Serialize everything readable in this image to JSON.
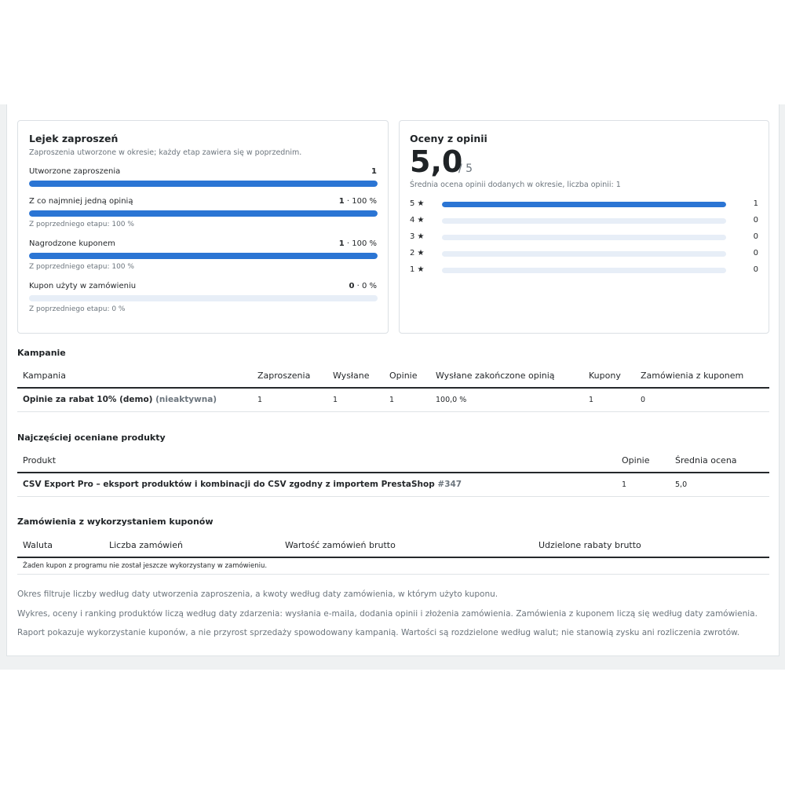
{
  "funnel": {
    "title": "Lejek zaproszeń",
    "subtitle": "Zaproszenia utworzone w okresie; każdy etap zawiera się w poprzednim.",
    "steps": [
      {
        "label": "Utworzone zaproszenia",
        "count": "1",
        "suffix": "",
        "fill": 1.0,
        "sub": ""
      },
      {
        "label": "Z co najmniej jedną opinią",
        "count": "1",
        "suffix": " · 100 %",
        "fill": 1.0,
        "sub": "Z poprzedniego etapu: 100 %"
      },
      {
        "label": "Nagrodzone kuponem",
        "count": "1",
        "suffix": " · 100 %",
        "fill": 1.0,
        "sub": "Z poprzedniego etapu: 100 %"
      },
      {
        "label": "Kupon użyty w zamówieniu",
        "count": "0",
        "suffix": " · 0 %",
        "fill": 0.0,
        "sub": "Z poprzedniego etapu: 0 %"
      }
    ]
  },
  "ratings": {
    "title": "Oceny z opinii",
    "average": "5,0",
    "max": "/ 5",
    "subtitle": "Średnia ocena opinii dodanych w okresie, liczba opinii: 1",
    "rows": [
      {
        "label": "5 ★",
        "count": "1",
        "fill": 1.0
      },
      {
        "label": "4 ★",
        "count": "0",
        "fill": 0.0
      },
      {
        "label": "3 ★",
        "count": "0",
        "fill": 0.0
      },
      {
        "label": "2 ★",
        "count": "0",
        "fill": 0.0
      },
      {
        "label": "1 ★",
        "count": "0",
        "fill": 0.0
      }
    ]
  },
  "campaigns": {
    "title": "Kampanie",
    "headers": [
      "Kampania",
      "Zaproszenia",
      "Wysłane",
      "Opinie",
      "Wysłane zakończone opinią",
      "Kupony",
      "Zamówienia z kuponem"
    ],
    "rows": [
      {
        "name": "Opinie za rabat 10% (demo)",
        "status": "(nieaktywna)",
        "cells": [
          "1",
          "1",
          "1",
          "100,0 %",
          "1",
          "0"
        ]
      }
    ]
  },
  "products": {
    "title": "Najczęściej oceniane produkty",
    "headers": [
      "Produkt",
      "Opinie",
      "Średnia ocena"
    ],
    "rows": [
      {
        "name": "CSV Export Pro – eksport produktów i kombinacji do CSV zgodny z importem PrestaShop",
        "id": "#347",
        "cells": [
          "1",
          "5,0"
        ]
      }
    ]
  },
  "orders": {
    "title": "Zamówienia z wykorzystaniem kuponów",
    "headers": [
      "Waluta",
      "Liczba zamówień",
      "Wartość zamówień brutto",
      "Udzielone rabaty brutto"
    ],
    "empty": "Żaden kupon z programu nie został jeszcze wykorzystany w zamówieniu."
  },
  "notes": [
    "Okres filtruje liczby według daty utworzenia zaproszenia, a kwoty według daty zamówienia, w którym użyto kuponu.",
    "Wykres, oceny i ranking produktów liczą według daty zdarzenia: wysłania e-maila, dodania opinii i złożenia zamówienia. Zamówienia z kuponem liczą się według daty zamówienia.",
    "Raport pokazuje wykorzystanie kuponów, a nie przyrost sprzedaży spowodowany kampanią. Wartości są rozdzielone według walut; nie stanowią zysku ani rozliczenia zwrotów."
  ],
  "colors": {
    "bar_fill": "#2b75d4",
    "bar_track": "#e7eef7"
  }
}
